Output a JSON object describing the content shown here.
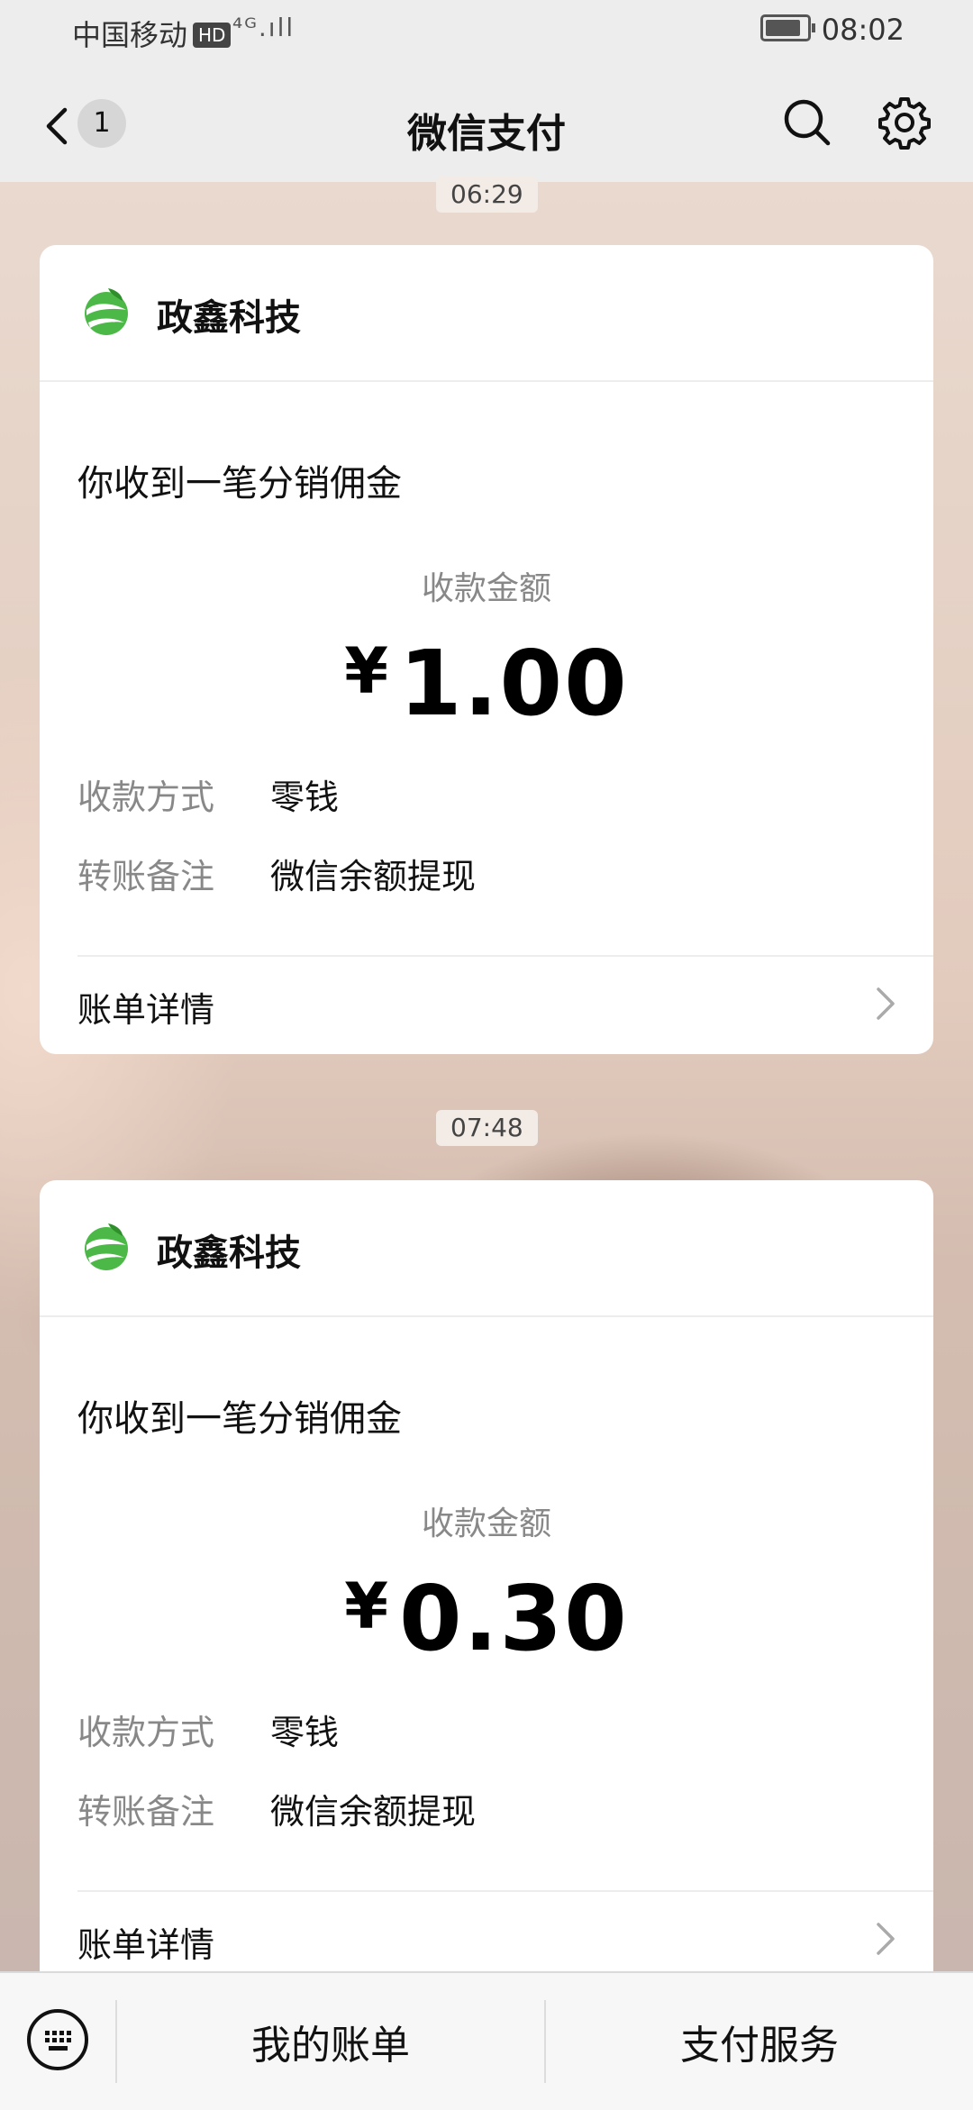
{
  "status_bar": {
    "carrier": "中国移动",
    "hd_badge": "HD",
    "signal_text": "⁴ᴳ.ıll",
    "time": "08:02"
  },
  "nav": {
    "back_count": "1",
    "title": "微信支付"
  },
  "messages": [
    {
      "timestamp": "06:29",
      "merchant": "政鑫科技",
      "notice": "你收到一笔分销佣金",
      "amount_label": "收款金额",
      "currency": "¥",
      "amount": "1.00",
      "method_label": "收款方式",
      "method_value": "零钱",
      "memo_label": "转账备注",
      "memo_value": "微信余额提现",
      "detail_label": "账单详情"
    },
    {
      "timestamp": "07:48",
      "merchant": "政鑫科技",
      "notice": "你收到一笔分销佣金",
      "amount_label": "收款金额",
      "currency": "¥",
      "amount": "0.30",
      "method_label": "收款方式",
      "method_value": "零钱",
      "memo_label": "转账备注",
      "memo_value": "微信余额提现",
      "detail_label": "账单详情"
    }
  ],
  "bottom_bar": {
    "my_bills": "我的账单",
    "pay_services": "支付服务"
  },
  "colors": {
    "nav_bg": "#ededed",
    "card_bg": "#ffffff",
    "muted_text": "#888888",
    "logo_green": "#3fae3a"
  },
  "icons": [
    "back-arrow-icon",
    "search-icon",
    "gear-icon",
    "keyboard-icon",
    "chevron-right-icon",
    "merchant-logo-icon",
    "battery-icon"
  ]
}
